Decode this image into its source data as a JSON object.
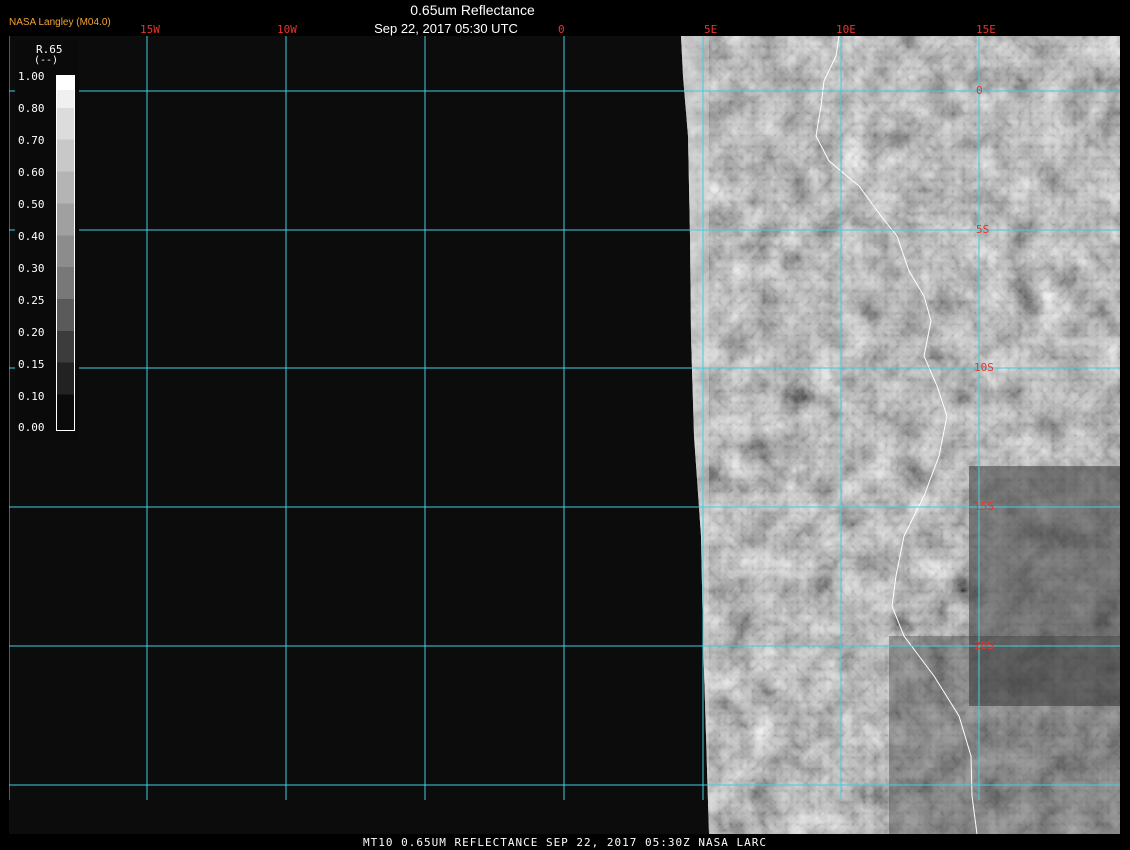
{
  "header": {
    "title": "0.65um Reflectance",
    "datetime": "Sep 22, 2017 05:30 UTC",
    "credit": "NASA Langley (M04.0)"
  },
  "lon_labels": [
    "15W",
    "10W",
    "0",
    "5E",
    "10E",
    "15E"
  ],
  "lat_labels": [
    "0",
    "5S",
    "10S",
    "15S",
    "20S"
  ],
  "legend": {
    "title": "R.65",
    "units": "(--)",
    "ticks": [
      "1.00",
      "0.80",
      "0.70",
      "0.60",
      "0.50",
      "0.40",
      "0.30",
      "0.25",
      "0.20",
      "0.15",
      "0.10",
      "0.00"
    ]
  },
  "footer": {
    "text": "MT10  0.65UM REFLECTANCE   SEP 22, 2017 05:30Z   NASA LARC"
  },
  "colors": {
    "grid": "#3fd0e0",
    "grid_label": "#e8342d",
    "credit": "#f4a533",
    "background": "#0c0c0c"
  }
}
